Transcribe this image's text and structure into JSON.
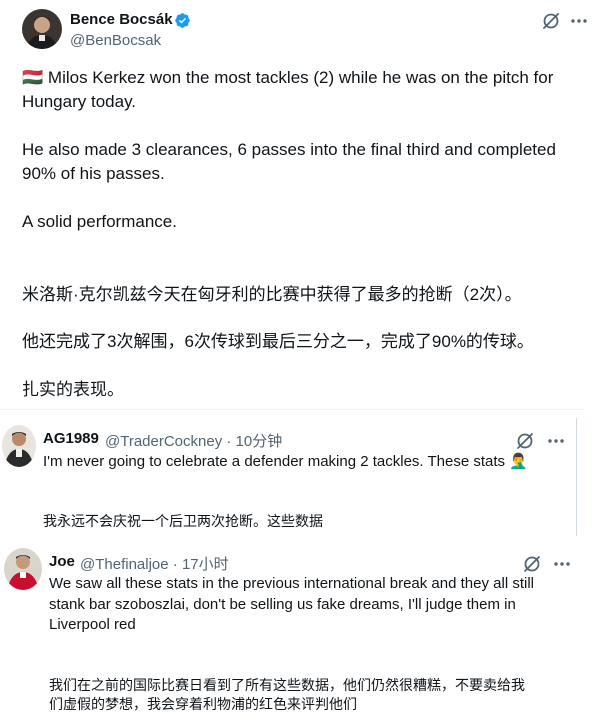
{
  "post": {
    "author_name": "Bence Bocsák",
    "author_handle": "@BenBocsak",
    "flag": "🇭🇺",
    "lines_en": [
      "Milos Kerkez won the most tackles (2) while he was on the pitch for",
      "Hungary today.",
      "He also made 3 clearances, 6 passes into the final third and completed",
      "90% of his passes.",
      "A solid performance."
    ],
    "lines_cn": [
      "米洛斯·克尔凯兹今天在匈牙利的比赛中获得了最多的抢断（2次）。",
      "他还完成了3次解围，6次传球到最后三分之一，完成了90%的传球。",
      "扎实的表现。"
    ]
  },
  "replies": [
    {
      "name": "AG1989",
      "handle_line": "@TraderCockney · 10分钟",
      "lines_en": [
        "I'm never going to celebrate a defender making 2 tackles. These stats 🤦‍♂️"
      ],
      "lines_cn": [
        "我永远不会庆祝一个后卫两次抢断。这些数据"
      ]
    },
    {
      "name": "Joe",
      "handle_line": "@Thefinaljoe · 17小时",
      "lines_en": [
        "We saw all these stats in the previous international break and they all still",
        "stank bar szoboszlai, don't be selling us fake dreams, I'll judge them in",
        "Liverpool red"
      ],
      "lines_cn": [
        "我们在之前的国际比赛日看到了所有这些数据，他们仍然很糟糕，不要卖给我",
        "们虚假的梦想，我会穿着利物浦的红色来评判他们"
      ]
    }
  ],
  "icons": {
    "verified": "verified-badge-icon",
    "grok": "grok-icon",
    "more": "more-options-icon"
  },
  "colors": {
    "text": "#0f1419",
    "secondary": "#536471",
    "verified": "#1d9bf0",
    "divider": "#eff3f4"
  }
}
